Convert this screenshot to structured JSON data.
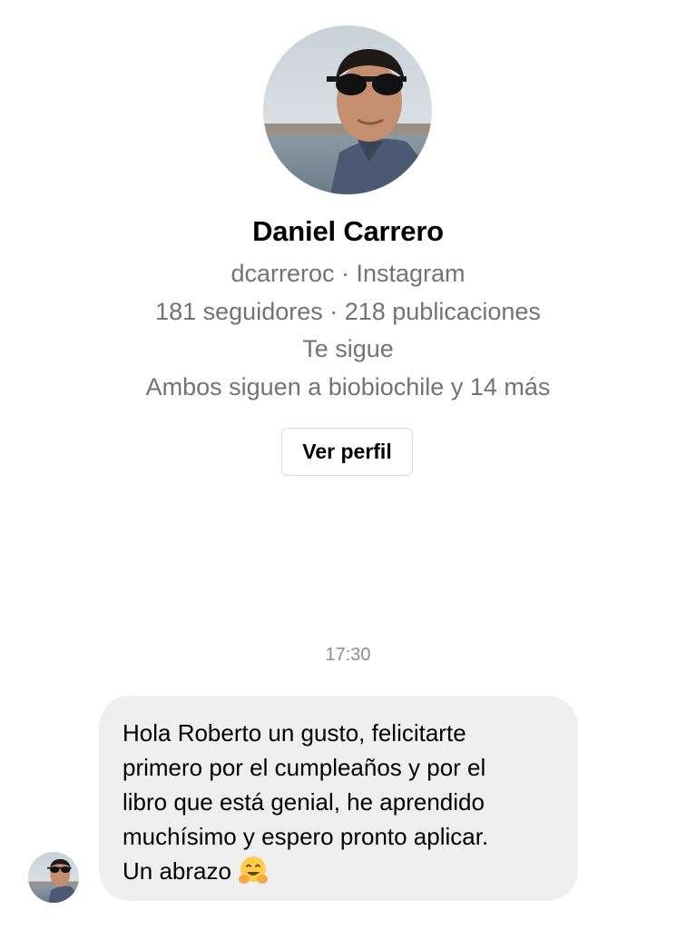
{
  "profile": {
    "name": "Daniel Carrero",
    "handle_line": "dcarreroc · Instagram",
    "stats_line": "181 seguidores · 218 publicaciones",
    "follows_you": "Te sigue",
    "mutual_line": "Ambos siguen a biobiochile y 14 más",
    "view_profile_label": "Ver perfil",
    "avatar_icon": "profile-photo"
  },
  "thread": {
    "timestamp": "17:30",
    "messages": [
      {
        "lines": [
          "Hola Roberto un gusto, felicitarte",
          "primero por el cumpleaños y por el",
          "libro que está genial, he aprendido",
          "muchísimo y espero pronto aplicar.",
          "Un abrazo"
        ],
        "emoji": "smiling-face-with-open-hands",
        "sender_avatar_icon": "profile-photo"
      }
    ]
  },
  "colors": {
    "secondary_text": "#737373",
    "timestamp_text": "#8e8e8e",
    "bubble_background": "#efefef",
    "button_border": "#dbdbdb"
  }
}
